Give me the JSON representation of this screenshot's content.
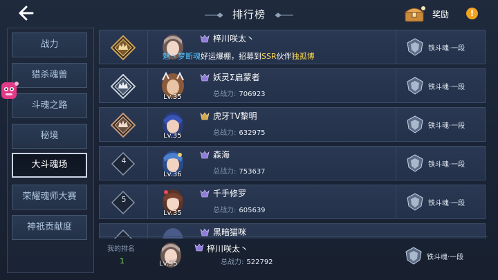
{
  "header": {
    "title": "排行榜",
    "reward_label": "奖励",
    "info_symbol": "!"
  },
  "sidebar": {
    "items": [
      {
        "label": "战力",
        "active": false
      },
      {
        "label": "猎杀魂兽",
        "active": false
      },
      {
        "label": "斗魂之路",
        "active": false
      },
      {
        "label": "秘境",
        "active": false
      },
      {
        "label": "大斗魂场",
        "active": true
      },
      {
        "label": "荣耀魂师大赛",
        "active": false
      },
      {
        "label": "神祇贡献度",
        "active": false
      }
    ]
  },
  "marquee": {
    "part1": "魅丶梦断魂",
    "part2": "好运爆棚，招募到",
    "part3": "SSR",
    "part4": "伙伴",
    "part5": "独孤博"
  },
  "rows": [
    {
      "rank": "1",
      "name": "梓川咲太丶",
      "lv": "",
      "power_label": "总战力:",
      "power": "",
      "segment": "铁斗魂·一段"
    },
    {
      "rank": "2",
      "name": "妖灵Σ启蒙者",
      "lv": "Lv.35",
      "power_label": "总战力:",
      "power": "706923",
      "segment": "铁斗魂·一段"
    },
    {
      "rank": "3",
      "name": "虎牙TV黎明",
      "lv": "Lv.35",
      "power_label": "总战力:",
      "power": "632975",
      "segment": "铁斗魂·一段"
    },
    {
      "rank": "4",
      "name": "森海",
      "lv": "Lv.36",
      "power_label": "总战力:",
      "power": "753637",
      "segment": "铁斗魂·一段"
    },
    {
      "rank": "5",
      "name": "千手修罗",
      "lv": "Lv.35",
      "power_label": "总战力:",
      "power": "605639",
      "segment": "铁斗魂·一段"
    },
    {
      "rank": "",
      "name": "黑暗猫咪",
      "lv": "",
      "power_label": "",
      "power": "",
      "segment": ""
    }
  ],
  "my": {
    "rank_label": "我的排名",
    "rank": "1",
    "name": "梓川咲太丶",
    "lv": "Lv.35",
    "power_label": "总战力:",
    "power": "522792",
    "segment": "铁斗魂·一段"
  },
  "colors": {
    "accent_blue": "#52c6ff",
    "accent_yellow": "#ffd84a",
    "rank_green": "#7ee05a",
    "info_orange": "#f2a321"
  }
}
